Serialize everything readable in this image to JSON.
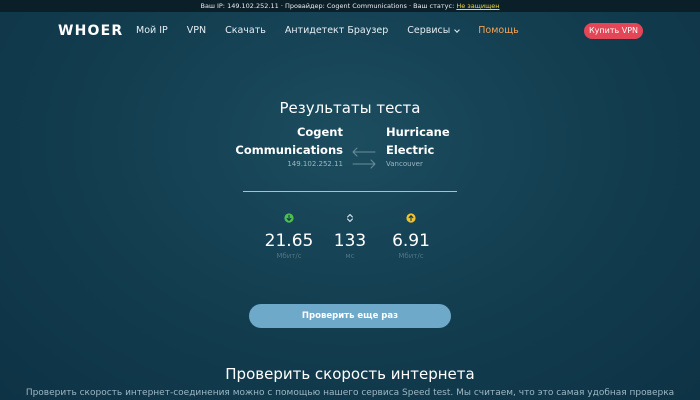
{
  "topbar": {
    "ip_label": "Ваш IP: 149.102.252.11",
    "sep1": " · ",
    "provider_label": "Провайдер: Cogent Communications",
    "sep2": " · ",
    "status_label": "Ваш статус: ",
    "status_value": "Не защищен",
    "status_color": "#f1d547"
  },
  "header": {
    "logo": "WHOER",
    "nav": {
      "my_ip": "Мой IP",
      "vpn": "VPN",
      "download": "Скачать",
      "antidetect": "Антидетект Браузер",
      "services": "Сервисы",
      "help": "Помощь"
    },
    "buy_vpn": "Купить VPN",
    "accent_color": "#e34656",
    "help_color": "#f3a25a"
  },
  "results": {
    "title": "Результаты теста",
    "from": {
      "name_line1": "Cogent",
      "name_line2": "Communications",
      "ip": "149.102.252.11"
    },
    "to": {
      "name_line1": "Hurricane",
      "name_line2": "Electric",
      "location": "Vancouver"
    },
    "metrics": {
      "download": {
        "value": "21.65",
        "unit": "Мбит/с",
        "icon": "download-arrow-icon",
        "color": "#4cc24a"
      },
      "ping": {
        "value": "133",
        "unit": "мс",
        "icon": "ping-chevrons-icon",
        "color": "#d6e2e8"
      },
      "upload": {
        "value": "6.91",
        "unit": "Мбит/с",
        "icon": "upload-arrow-icon",
        "color": "#f1c232"
      }
    },
    "retry": "Проверить еще раз"
  },
  "section": {
    "title": "Проверить скорость интернета",
    "text": "Проверить скорость интернет-соединения можно с помощью нашего сервиса Speed test. Мы считаем, что это самая удобная проверка"
  }
}
